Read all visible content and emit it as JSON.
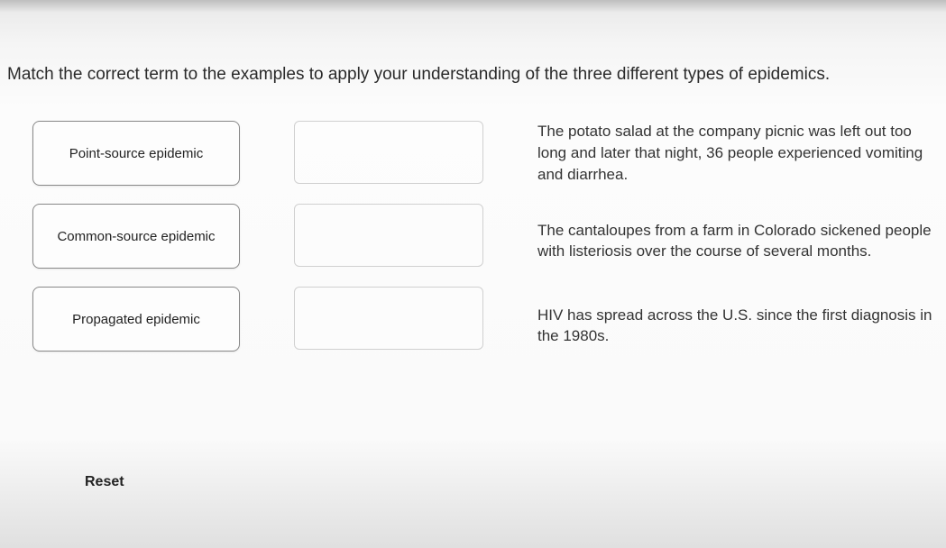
{
  "prompt": "Match the correct term to the examples to apply your understanding of the three different types of epidemics.",
  "terms": [
    {
      "label": "Point-source epidemic"
    },
    {
      "label": "Common-source epidemic"
    },
    {
      "label": "Propagated epidemic"
    }
  ],
  "descriptions": [
    {
      "text": "The potato salad at the company picnic was left out too long and later that night, 36 people experienced vomiting and diarrhea."
    },
    {
      "text": "The cantaloupes from a farm in Colorado sickened people with listeriosis over the course of several months."
    },
    {
      "text": "HIV has spread across the U.S. since the first diagnosis in the 1980s."
    }
  ],
  "controls": {
    "reset_label": "Reset"
  }
}
